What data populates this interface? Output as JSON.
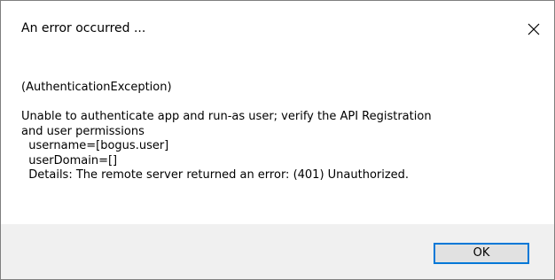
{
  "dialog": {
    "title": "An error occurred ...",
    "close_icon": "close-icon",
    "message_lines": [
      "(AuthenticationException)",
      "",
      "Unable to authenticate app and run-as user; verify the API Registration",
      "and user permissions",
      "  username=[bogus.user]",
      "  userDomain=[]",
      "  Details: The remote server returned an error: (401) Unauthorized."
    ],
    "ok_label": "OK"
  },
  "colors": {
    "footer_bg": "#f0f0f0",
    "button_bg": "#e1e1e1",
    "button_focus_border": "#0078d7",
    "window_border": "#7f7f7f"
  }
}
